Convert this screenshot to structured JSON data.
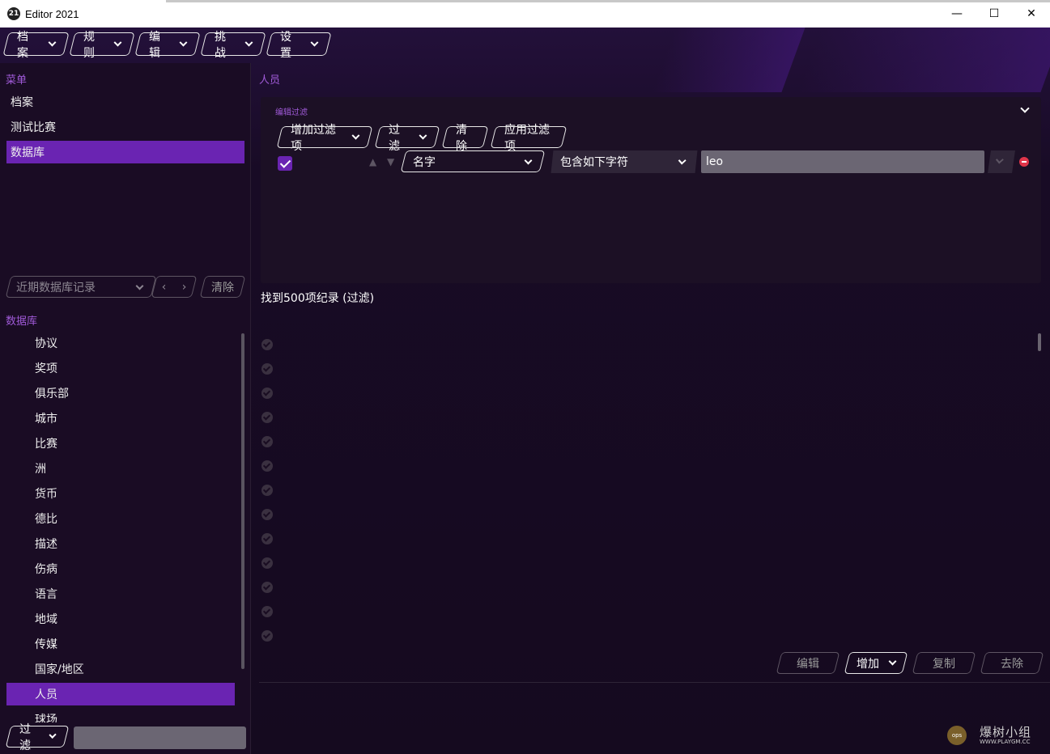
{
  "window": {
    "title": "Editor 2021",
    "icon_text": "21",
    "controls": [
      "—",
      "☐",
      "✕"
    ]
  },
  "menubar": [
    {
      "label": "档案"
    },
    {
      "label": "规则"
    },
    {
      "label": "编辑"
    },
    {
      "label": "挑战"
    },
    {
      "label": "设置"
    }
  ],
  "sidebar": {
    "menu_title": "菜单",
    "menu_items": [
      {
        "label": "档案",
        "active": false
      },
      {
        "label": "测试比赛",
        "active": false
      },
      {
        "label": "数据库",
        "active": true
      }
    ],
    "recent_placeholder": "近期数据库记录",
    "nav_prev": "‹",
    "nav_next": "›",
    "clear_label": "清除",
    "db_title": "数据库",
    "db_items": [
      {
        "label": "协议"
      },
      {
        "label": "奖项"
      },
      {
        "label": "俱乐部"
      },
      {
        "label": "城市"
      },
      {
        "label": "比赛"
      },
      {
        "label": "洲"
      },
      {
        "label": "货币"
      },
      {
        "label": "德比"
      },
      {
        "label": "描述"
      },
      {
        "label": "伤病"
      },
      {
        "label": "语言"
      },
      {
        "label": "地域"
      },
      {
        "label": "传媒"
      },
      {
        "label": "国家/地区"
      },
      {
        "label": "人员",
        "active": true
      },
      {
        "label": "球场"
      }
    ],
    "bottom_filter_label": "过滤",
    "bottom_input_value": ""
  },
  "main": {
    "title": "人员",
    "filter_panel": {
      "label": "编辑过滤",
      "buttons": [
        {
          "label": "增加过滤项",
          "dropdown": true
        },
        {
          "label": "过滤",
          "dropdown": true
        },
        {
          "label": "清除",
          "dropdown": false
        },
        {
          "label": "应用过滤项",
          "dropdown": false
        }
      ],
      "rule": {
        "enabled": true,
        "field": "名字",
        "condition": "包含如下字符",
        "value": "leo"
      }
    },
    "results_label": "找到500项纪录 (过滤)",
    "visible_rows": 13,
    "actions": [
      {
        "label": "编辑",
        "enabled": false,
        "dropdown": false
      },
      {
        "label": "增加",
        "enabled": true,
        "dropdown": true
      },
      {
        "label": "复制",
        "enabled": false,
        "dropdown": false
      },
      {
        "label": "去除",
        "enabled": false,
        "dropdown": false
      }
    ]
  },
  "watermark": {
    "badge": "ops",
    "text": "爆树小组",
    "url": "WWW.PLAYGM.CC"
  },
  "colors": {
    "accent": "#6a24b2",
    "section_label": "#a05ad8",
    "background": "#1a0d22",
    "remove": "#e0354a"
  }
}
